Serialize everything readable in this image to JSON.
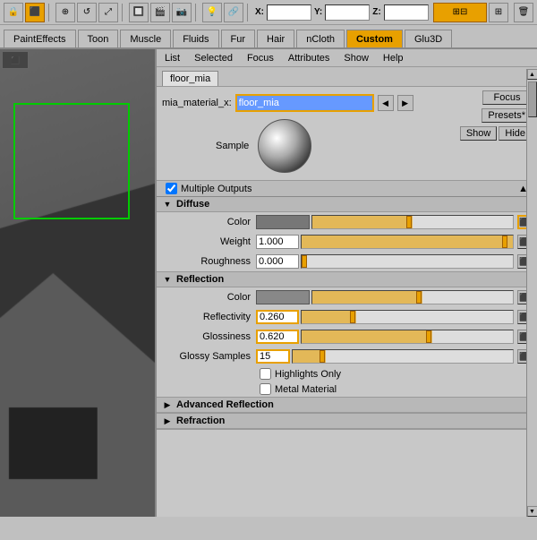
{
  "toolbar": {
    "xyz": {
      "x_label": "X:",
      "y_label": "Y:",
      "z_label": "Z:"
    },
    "tabs": [
      "PaintEffects",
      "Toon",
      "Muscle",
      "Fluids",
      "Fur",
      "Hair",
      "nCloth",
      "Custom",
      "Glu3D"
    ],
    "active_tab": "Custom"
  },
  "panel": {
    "menu_items": [
      "List",
      "Selected",
      "Focus",
      "Attributes",
      "Show",
      "Help"
    ],
    "active_tab": "floor_mia",
    "material_name_label": "mia_material_x:",
    "material_name_value": "floor_mia",
    "focus_btn": "Focus",
    "presets_btn": "Presets*",
    "show_btn": "Show",
    "hide_btn": "Hide",
    "sample_label": "Sample",
    "multiple_outputs_label": "Multiple Outputs",
    "sections": {
      "diffuse": {
        "title": "Diffuse",
        "color_label": "Color",
        "weight_label": "Weight",
        "weight_value": "1.000",
        "roughness_label": "Roughness",
        "roughness_value": "0.000"
      },
      "reflection": {
        "title": "Reflection",
        "color_label": "Color",
        "reflectivity_label": "Reflectivity",
        "reflectivity_value": "0.260",
        "glossiness_label": "Glossiness",
        "glossiness_value": "0.620",
        "glossy_samples_label": "Glossy Samples",
        "glossy_samples_value": "15",
        "highlights_only_label": "Highlights Only",
        "metal_material_label": "Metal Material"
      },
      "adv_reflection": {
        "title": "Advanced Reflection"
      },
      "refraction": {
        "title": "Refraction"
      }
    }
  }
}
